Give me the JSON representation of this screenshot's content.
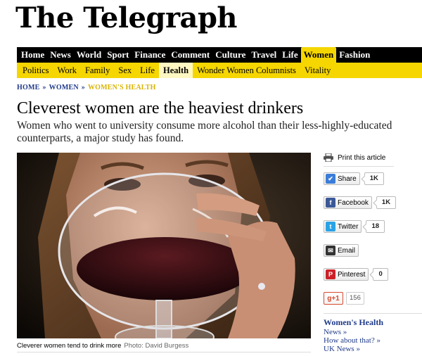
{
  "masthead": {
    "logo": "The Telegraph"
  },
  "nav": {
    "items": [
      "Home",
      "News",
      "World",
      "Sport",
      "Finance",
      "Comment",
      "Culture",
      "Travel",
      "Life",
      "Women",
      "Fashion"
    ],
    "active": "Women"
  },
  "subnav": {
    "items": [
      "Politics",
      "Work",
      "Family",
      "Sex",
      "Life",
      "Health",
      "Wonder Women Columnists",
      "Vitality"
    ],
    "active": "Health"
  },
  "breadcrumb": {
    "home": "Home",
    "women": "Women",
    "current": "Women's Health",
    "separator": "»"
  },
  "article": {
    "headline": "Cleverest women are the heaviest drinkers",
    "standfirst": "Women who went to university consume more alcohol than their less-highly-educated counterparts, a major study has found.",
    "caption": "Cleverer women tend to drink more",
    "credit": "Photo: David Burgess"
  },
  "sidebar": {
    "print": "Print this article",
    "share": {
      "label": "Share",
      "count": "1K"
    },
    "facebook": {
      "label": "Facebook",
      "count": "1K"
    },
    "twitter": {
      "label": "Twitter",
      "count": "18"
    },
    "email": {
      "label": "Email"
    },
    "pinterest": {
      "label": "Pinterest",
      "count": "0"
    },
    "gplus": {
      "label": "g+1",
      "count": "156"
    },
    "section_title": "Women's Health",
    "links": [
      "News »",
      "How about that? »",
      "UK News »"
    ]
  },
  "colors": {
    "accent": "#f5d600",
    "link": "#1f3a8a",
    "nav_bg": "#000000"
  }
}
